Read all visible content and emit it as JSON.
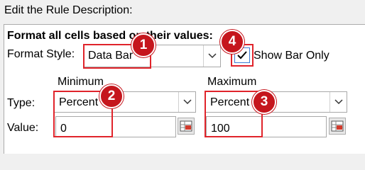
{
  "section_title": "Edit the Rule Description:",
  "panel": {
    "heading": "Format all cells based on their values:",
    "format_style_label": "Format Style:",
    "format_style_value": "Data Bar",
    "show_bar_only_label": "Show Bar Only",
    "show_bar_only_checked": true,
    "minimum": {
      "header": "Minimum",
      "type_label": "Type:",
      "type_value": "Percent",
      "value_label": "Value:",
      "value": "0"
    },
    "maximum": {
      "header": "Maximum",
      "type_value": "Percent",
      "value": "100"
    }
  },
  "badges": [
    "1",
    "2",
    "3",
    "4"
  ],
  "colors": {
    "highlight": "#e0242b",
    "badge": "#c5161d",
    "checkbox_accent": "#3b7bd4"
  }
}
